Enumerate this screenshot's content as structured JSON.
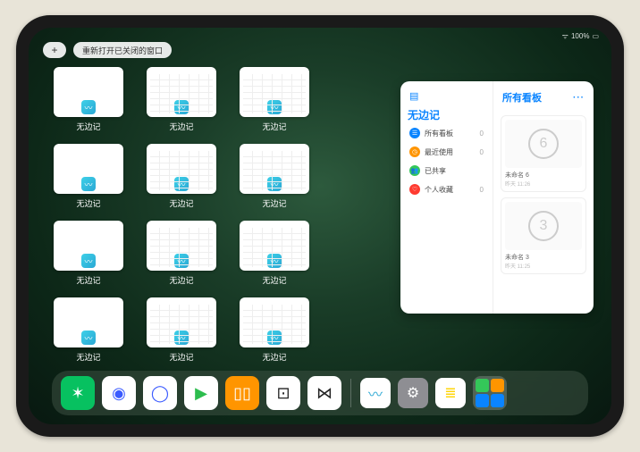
{
  "status": {
    "wifi": "⋮⋮",
    "battery": "100%"
  },
  "topbar": {
    "plus": "+",
    "reopen_label": "重新打开已关闭的窗口"
  },
  "windows": [
    {
      "label": "无边记",
      "style": "blank"
    },
    {
      "label": "无边记",
      "style": "calendar"
    },
    {
      "label": "无边记",
      "style": "calendar"
    },
    {
      "label": "无边记",
      "style": "blank"
    },
    {
      "label": "无边记",
      "style": "calendar"
    },
    {
      "label": "无边记",
      "style": "calendar"
    },
    {
      "label": "无边记",
      "style": "blank"
    },
    {
      "label": "无边记",
      "style": "calendar"
    },
    {
      "label": "无边记",
      "style": "calendar"
    },
    {
      "label": "无边记",
      "style": "blank"
    },
    {
      "label": "无边记",
      "style": "calendar"
    },
    {
      "label": "无边记",
      "style": "calendar"
    }
  ],
  "panel": {
    "left_title": "无边记",
    "right_title": "所有看板",
    "menu": [
      {
        "label": "所有看板",
        "count": "0",
        "color": "#0a84ff",
        "glyph": "☰"
      },
      {
        "label": "最近使用",
        "count": "0",
        "color": "#ff9500",
        "glyph": "◷"
      },
      {
        "label": "已共享",
        "count": "",
        "color": "#34c759",
        "glyph": "👥"
      },
      {
        "label": "个人收藏",
        "count": "0",
        "color": "#ff3b30",
        "glyph": "♡"
      }
    ],
    "boards": [
      {
        "title": "未命名 6",
        "sub": "昨天 11:26",
        "digit": "6"
      },
      {
        "title": "未命名 3",
        "sub": "昨天 11:25",
        "digit": "3"
      }
    ],
    "more": "···"
  },
  "dock": {
    "apps": [
      {
        "name": "wechat",
        "bg": "#07c160",
        "glyph": "✶"
      },
      {
        "name": "quark-hd",
        "bg": "#ffffff",
        "glyph": "◉",
        "fg": "#3b5bff"
      },
      {
        "name": "quark",
        "bg": "#ffffff",
        "glyph": "◯",
        "fg": "#3b5bff"
      },
      {
        "name": "play",
        "bg": "#ffffff",
        "glyph": "▶",
        "fg": "#2dbd4e"
      },
      {
        "name": "books",
        "bg": "#ff9500",
        "glyph": "▯▯"
      },
      {
        "name": "dice",
        "bg": "#ffffff",
        "glyph": "⊡",
        "fg": "#222"
      },
      {
        "name": "connect",
        "bg": "#ffffff",
        "glyph": "⋈",
        "fg": "#222"
      }
    ],
    "recent": [
      {
        "name": "freeform",
        "bg": "#ffffff",
        "glyph": "〰",
        "fg": "#2ba8d4"
      },
      {
        "name": "settings",
        "bg": "#8e8e93",
        "glyph": "⚙"
      },
      {
        "name": "notes",
        "bg": "#ffffff",
        "glyph": "≣",
        "fg": "#ffd60a"
      }
    ],
    "folder_colors": [
      "#34c759",
      "#ff9500",
      "#0a84ff",
      "#0a84ff"
    ]
  }
}
